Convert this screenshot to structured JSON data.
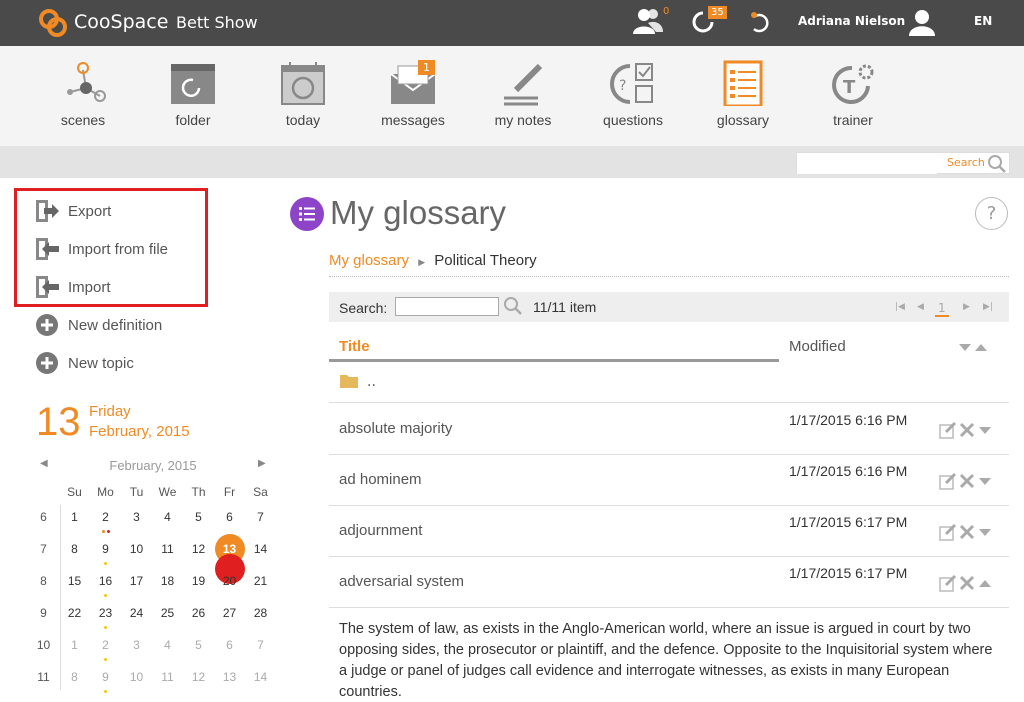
{
  "header": {
    "brand": "CooSpace",
    "course": "Bett Show",
    "user_name": "Adriana Nielson",
    "lang": "EN",
    "notif_users_count": "0",
    "notif_updates_count": "35"
  },
  "toolbar": {
    "items": [
      {
        "label": "scenes"
      },
      {
        "label": "folder"
      },
      {
        "label": "today"
      },
      {
        "label": "messages",
        "badge": "1"
      },
      {
        "label": "my notes"
      },
      {
        "label": "questions"
      },
      {
        "label": "glossary"
      },
      {
        "label": "trainer"
      }
    ]
  },
  "top_search": {
    "placeholder": "Search"
  },
  "actions": {
    "export": "Export",
    "import_file": "Import from file",
    "import": "Import",
    "new_definition": "New definition",
    "new_topic": "New topic"
  },
  "calendar": {
    "day": "13",
    "weekday": "Friday",
    "month_year": "February, 2015",
    "nav_month": "February, 2015",
    "headers": [
      "Su",
      "Mo",
      "Tu",
      "We",
      "Th",
      "Fr",
      "Sa"
    ],
    "weeks": [
      {
        "wk": "6",
        "days": [
          "1",
          "2",
          "3",
          "4",
          "5",
          "6",
          "7"
        ]
      },
      {
        "wk": "7",
        "days": [
          "8",
          "9",
          "10",
          "11",
          "12",
          "13",
          "14"
        ]
      },
      {
        "wk": "8",
        "days": [
          "15",
          "16",
          "17",
          "18",
          "19",
          "20",
          "21"
        ]
      },
      {
        "wk": "9",
        "days": [
          "22",
          "23",
          "24",
          "25",
          "26",
          "27",
          "28"
        ]
      },
      {
        "wk": "10",
        "days": [
          "1",
          "2",
          "3",
          "4",
          "5",
          "6",
          "7"
        ]
      },
      {
        "wk": "11",
        "days": [
          "8",
          "9",
          "10",
          "11",
          "12",
          "13",
          "14"
        ]
      }
    ]
  },
  "main": {
    "title": "My glossary",
    "breadcrumb_root": "My glossary",
    "breadcrumb_current": "Political Theory",
    "search_label": "Search:",
    "item_count": "11/11 item",
    "page": "1",
    "col_title": "Title",
    "col_modified": "Modified",
    "folder_up": "..",
    "rows": [
      {
        "name": "absolute majority",
        "date": "1/17/2015 6:16 PM"
      },
      {
        "name": "ad hominem",
        "date": "1/17/2015 6:16 PM"
      },
      {
        "name": "adjournment",
        "date": "1/17/2015 6:17 PM"
      },
      {
        "name": "adversarial system",
        "date": "1/17/2015 6:17 PM"
      }
    ],
    "definition": "The system of law, as exists in the Anglo-American world, where an issue is argued in court by two opposing sides, the prosecutor or plaintiff, and the defence. Opposite to the Inquisitorial system where a judge or panel of judges call evidence and interrogate witnesses, as exists in many European countries."
  },
  "colors": {
    "accent": "#f08a24",
    "topbar": "#4a4a4a",
    "purple": "#8e44c8",
    "highlight_box": "#e02020"
  }
}
